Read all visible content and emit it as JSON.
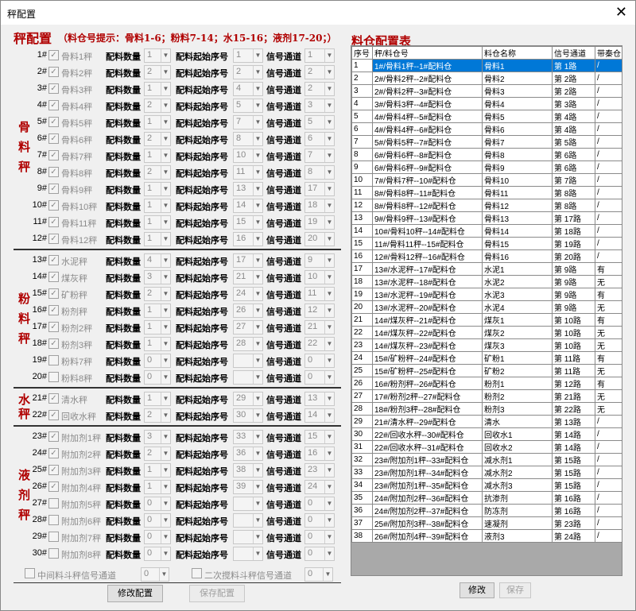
{
  "window": {
    "title": "秤配置",
    "close_glyph": "✕"
  },
  "cfg": {
    "title": "秤配置",
    "hint": "（料仓号提示：骨料1-6；粉料7-14；水15-16；液剂17-20；）",
    "labels": {
      "qty": "配料数量",
      "start": "配料起始序号",
      "chan": "信号通道"
    },
    "groups": [
      {
        "name": "骨料秤",
        "chars": [
          "骨",
          "料",
          "秤"
        ]
      },
      {
        "name": "粉料秤",
        "chars": [
          "粉",
          "料",
          "秤"
        ]
      },
      {
        "name": "水秤",
        "chars": [
          "水",
          "秤"
        ]
      },
      {
        "name": "液剂秤",
        "chars": [
          "液",
          "剂",
          "秤"
        ]
      }
    ],
    "rows": [
      {
        "n": "1#",
        "name": "骨料1秤",
        "checked": true,
        "qty": "1",
        "start": "1",
        "chan": "1"
      },
      {
        "n": "2#",
        "name": "骨料2秤",
        "checked": true,
        "qty": "2",
        "start": "2",
        "chan": "2"
      },
      {
        "n": "3#",
        "name": "骨料3秤",
        "checked": true,
        "qty": "1",
        "start": "4",
        "chan": "2"
      },
      {
        "n": "4#",
        "name": "骨料4秤",
        "checked": true,
        "qty": "2",
        "start": "5",
        "chan": "3"
      },
      {
        "n": "5#",
        "name": "骨料5秤",
        "checked": true,
        "qty": "1",
        "start": "7",
        "chan": "5"
      },
      {
        "n": "6#",
        "name": "骨料6秤",
        "checked": true,
        "qty": "2",
        "start": "8",
        "chan": "6"
      },
      {
        "n": "7#",
        "name": "骨料7秤",
        "checked": true,
        "qty": "1",
        "start": "10",
        "chan": "7"
      },
      {
        "n": "8#",
        "name": "骨料8秤",
        "checked": true,
        "qty": "2",
        "start": "11",
        "chan": "8"
      },
      {
        "n": "9#",
        "name": "骨料9秤",
        "checked": true,
        "qty": "1",
        "start": "13",
        "chan": "17"
      },
      {
        "n": "10#",
        "name": "骨料10秤",
        "checked": true,
        "qty": "1",
        "start": "14",
        "chan": "18"
      },
      {
        "n": "11#",
        "name": "骨料11秤",
        "checked": true,
        "qty": "1",
        "start": "15",
        "chan": "19"
      },
      {
        "n": "12#",
        "name": "骨料12秤",
        "checked": true,
        "qty": "1",
        "start": "16",
        "chan": "20"
      },
      {
        "n": "13#",
        "name": "水泥秤",
        "checked": true,
        "qty": "4",
        "start": "17",
        "chan": "9"
      },
      {
        "n": "14#",
        "name": "煤灰秤",
        "checked": true,
        "qty": "3",
        "start": "21",
        "chan": "10"
      },
      {
        "n": "15#",
        "name": "矿粉秤",
        "checked": true,
        "qty": "2",
        "start": "24",
        "chan": "11"
      },
      {
        "n": "16#",
        "name": "粉剂秤",
        "checked": true,
        "qty": "1",
        "start": "26",
        "chan": "12"
      },
      {
        "n": "17#",
        "name": "粉剂2秤",
        "checked": true,
        "qty": "1",
        "start": "27",
        "chan": "21"
      },
      {
        "n": "18#",
        "name": "粉剂3秤",
        "checked": true,
        "qty": "1",
        "start": "28",
        "chan": "22"
      },
      {
        "n": "19#",
        "name": "粉料7秤",
        "checked": false,
        "qty": "0",
        "start": "",
        "chan": "0"
      },
      {
        "n": "20#",
        "name": "粉料8秤",
        "checked": false,
        "qty": "0",
        "start": "",
        "chan": "0"
      },
      {
        "n": "21#",
        "name": "清水秤",
        "checked": true,
        "qty": "1",
        "start": "29",
        "chan": "13"
      },
      {
        "n": "22#",
        "name": "回收水秤",
        "checked": true,
        "qty": "2",
        "start": "30",
        "chan": "14"
      },
      {
        "n": "23#",
        "name": "附加剂1秤",
        "checked": true,
        "qty": "3",
        "start": "33",
        "chan": "15"
      },
      {
        "n": "24#",
        "name": "附加剂2秤",
        "checked": true,
        "qty": "2",
        "start": "36",
        "chan": "16"
      },
      {
        "n": "25#",
        "name": "附加剂3秤",
        "checked": true,
        "qty": "1",
        "start": "38",
        "chan": "23"
      },
      {
        "n": "26#",
        "name": "附加剂4秤",
        "checked": true,
        "qty": "1",
        "start": "39",
        "chan": "24"
      },
      {
        "n": "27#",
        "name": "附加剂5秤",
        "checked": false,
        "qty": "0",
        "start": "",
        "chan": "0"
      },
      {
        "n": "28#",
        "name": "附加剂6秤",
        "checked": false,
        "qty": "0",
        "start": "",
        "chan": "0"
      },
      {
        "n": "29#",
        "name": "附加剂7秤",
        "checked": false,
        "qty": "0",
        "start": "",
        "chan": "0"
      },
      {
        "n": "30#",
        "name": "附加剂8秤",
        "checked": false,
        "qty": "0",
        "start": "",
        "chan": "0"
      }
    ],
    "footer": {
      "opt1": "中间料斗秤信号通道",
      "val1": "0",
      "opt2": "二次搅料斗秤信号通道",
      "val2": "0"
    },
    "buttons": {
      "edit": "修改配置",
      "save": "保存配置"
    }
  },
  "bin_table": {
    "title": "料仓配置表",
    "headers": [
      "序号",
      "秤/料仓号",
      "料仓名称",
      "信号通道",
      "带秦仓"
    ],
    "rows": [
      [
        "1",
        "1#/骨料1秤--1#配料仓",
        "骨料1",
        "第 1路",
        "/"
      ],
      [
        "2",
        "2#/骨料2秤--2#配料仓",
        "骨料2",
        "第 2路",
        "/"
      ],
      [
        "3",
        "2#/骨料2秤--3#配料仓",
        "骨料3",
        "第 2路",
        "/"
      ],
      [
        "4",
        "3#/骨料3秤--4#配料仓",
        "骨料4",
        "第 3路",
        "/"
      ],
      [
        "5",
        "4#/骨料4秤--5#配料仓",
        "骨料5",
        "第 4路",
        "/"
      ],
      [
        "6",
        "4#/骨料4秤--6#配料仓",
        "骨料6",
        "第 4路",
        "/"
      ],
      [
        "7",
        "5#/骨料5秤--7#配料仓",
        "骨料7",
        "第 5路",
        "/"
      ],
      [
        "8",
        "6#/骨料6秤--8#配料仓",
        "骨料8",
        "第 6路",
        "/"
      ],
      [
        "9",
        "6#/骨料6秤--9#配料仓",
        "骨料9",
        "第 6路",
        "/"
      ],
      [
        "10",
        "7#/骨料7秤--10#配料仓",
        "骨料10",
        "第 7路",
        "/"
      ],
      [
        "11",
        "8#/骨料8秤--11#配料仓",
        "骨料11",
        "第 8路",
        "/"
      ],
      [
        "12",
        "8#/骨料8秤--12#配料仓",
        "骨料12",
        "第 8路",
        "/"
      ],
      [
        "13",
        "9#/骨料9秤--13#配料仓",
        "骨料13",
        "第 17路",
        "/"
      ],
      [
        "14",
        "10#/骨料10秤--14#配料仓",
        "骨料14",
        "第 18路",
        "/"
      ],
      [
        "15",
        "11#/骨料11秤--15#配料仓",
        "骨料15",
        "第 19路",
        "/"
      ],
      [
        "16",
        "12#/骨料12秤--16#配料仓",
        "骨料16",
        "第 20路",
        "/"
      ],
      [
        "17",
        "13#/水泥秤--17#配料仓",
        "水泥1",
        "第 9路",
        "有"
      ],
      [
        "18",
        "13#/水泥秤--18#配料仓",
        "水泥2",
        "第 9路",
        "无"
      ],
      [
        "19",
        "13#/水泥秤--19#配料仓",
        "水泥3",
        "第 9路",
        "有"
      ],
      [
        "20",
        "13#/水泥秤--20#配料仓",
        "水泥4",
        "第 9路",
        "无"
      ],
      [
        "21",
        "14#/煤灰秤--21#配料仓",
        "煤灰1",
        "第 10路",
        "有"
      ],
      [
        "22",
        "14#/煤灰秤--22#配料仓",
        "煤灰2",
        "第 10路",
        "无"
      ],
      [
        "23",
        "14#/煤灰秤--23#配料仓",
        "煤灰3",
        "第 10路",
        "无"
      ],
      [
        "24",
        "15#/矿粉秤--24#配料仓",
        "矿粉1",
        "第 11路",
        "有"
      ],
      [
        "25",
        "15#/矿粉秤--25#配料仓",
        "矿粉2",
        "第 11路",
        "无"
      ],
      [
        "26",
        "16#/粉剂秤--26#配料仓",
        "粉剂1",
        "第 12路",
        "有"
      ],
      [
        "27",
        "17#/粉剂2秤--27#配料仓",
        "粉剂2",
        "第 21路",
        "无"
      ],
      [
        "28",
        "18#/粉剂3秤--28#配料仓",
        "粉剂3",
        "第 22路",
        "无"
      ],
      [
        "29",
        "21#/清水秤--29#配料仓",
        "清水",
        "第 13路",
        "/"
      ],
      [
        "30",
        "22#/回收水秤--30#配料仓",
        "回收水1",
        "第 14路",
        "/"
      ],
      [
        "31",
        "22#/回收水秤--31#配料仓",
        "回收水2",
        "第 14路",
        "/"
      ],
      [
        "32",
        "23#/附加剂1秤--33#配料仓",
        "减水剂1",
        "第 15路",
        "/"
      ],
      [
        "33",
        "23#/附加剂1秤--34#配料仓",
        "减水剂2",
        "第 15路",
        "/"
      ],
      [
        "34",
        "23#/附加剂1秤--35#配料仓",
        "减水剂3",
        "第 15路",
        "/"
      ],
      [
        "35",
        "24#/附加剂2秤--36#配料仓",
        "抗渗剂",
        "第 16路",
        "/"
      ],
      [
        "36",
        "24#/附加剂2秤--37#配料仓",
        "防冻剂",
        "第 16路",
        "/"
      ],
      [
        "37",
        "25#/附加剂3秤--38#配料仓",
        "速凝剂",
        "第 23路",
        "/"
      ],
      [
        "38",
        "26#/附加剂4秤--39#配料仓",
        "液剂3",
        "第 24路",
        "/"
      ]
    ],
    "buttons": {
      "edit": "修改",
      "save": "保存"
    }
  }
}
